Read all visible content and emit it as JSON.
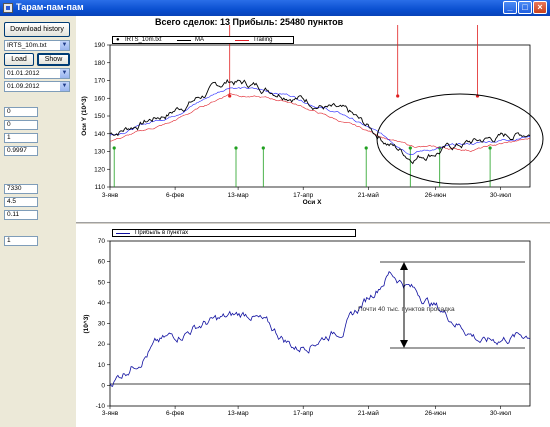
{
  "window": {
    "title": "Тарам-пам-пам"
  },
  "left": {
    "download_label": "Download history",
    "file_select": "IRTS_10m.txt",
    "load_label": "Load",
    "show_label": "Show",
    "date_from": "01.01.2012",
    "date_to": "01.09.2012",
    "params1": [
      "0",
      "0",
      "1",
      "0.9997"
    ],
    "params2": [
      "7330",
      "4.5",
      "0.11"
    ],
    "params3": [
      "1"
    ]
  },
  "top_chart": {
    "title": "Всего сделок:  13 Прибыль: 25480 пунктов",
    "legend": [
      "IRTS_10m.txt",
      "MA",
      "Trailing"
    ],
    "xlabel": "Оси X",
    "ylabel": "Оси Y (10^3)",
    "yticks": [
      "110",
      "120",
      "130",
      "140",
      "150",
      "160",
      "170",
      "180",
      "190"
    ],
    "xticks": [
      "3-янв",
      "6-фев",
      "13-мар",
      "17-апр",
      "21-май",
      "26-июн",
      "30-июл"
    ]
  },
  "bottom_chart": {
    "legend": [
      "Прибыль в пунктах"
    ],
    "ylabel": "(10^3)",
    "yticks": [
      "-10",
      "0",
      "10",
      "20",
      "30",
      "40",
      "50",
      "60",
      "70"
    ],
    "xticks": [
      "3-янв",
      "6-фев",
      "13-мар",
      "17-апр",
      "21-май",
      "26-июн",
      "30-июл"
    ],
    "annotation": "Почти 40 тыс. пунктов просадка"
  },
  "colors": {
    "price": "#000000",
    "ma": "#2020ff",
    "trailing": "#e0202a",
    "buy": "#20a020",
    "sell": "#e02020",
    "profit": "#1010a0"
  },
  "chart_data": [
    {
      "type": "line",
      "title": "Всего сделок:  13 Прибыль: 25480 пунктов",
      "xlabel": "Оси X",
      "ylabel": "Оси Y (10^3)",
      "ylim": [
        110,
        190
      ],
      "categories": [
        "3-янв",
        "6-фев",
        "13-мар",
        "17-апр",
        "21-май",
        "26-июн",
        "30-июл"
      ],
      "series": [
        {
          "name": "IRTS_10m.txt",
          "values": [
            140,
            152,
            170,
            163,
            150,
            127,
            135,
            141
          ]
        },
        {
          "name": "MA",
          "values": [
            139,
            150,
            167,
            162,
            149,
            130,
            134,
            139
          ]
        },
        {
          "name": "Trailing",
          "values": [
            136,
            146,
            163,
            158,
            145,
            133,
            131,
            137
          ]
        }
      ]
    },
    {
      "type": "line",
      "xlabel": "",
      "ylabel": "(10^3)",
      "ylim": [
        -10,
        70
      ],
      "categories": [
        "3-янв",
        "6-фев",
        "13-мар",
        "17-апр",
        "21-май",
        "26-июн",
        "30-июл"
      ],
      "series": [
        {
          "name": "Прибыль в пунктах",
          "values": [
            1,
            20,
            30,
            35,
            18,
            28,
            55,
            38,
            21,
            25
          ]
        }
      ]
    }
  ]
}
